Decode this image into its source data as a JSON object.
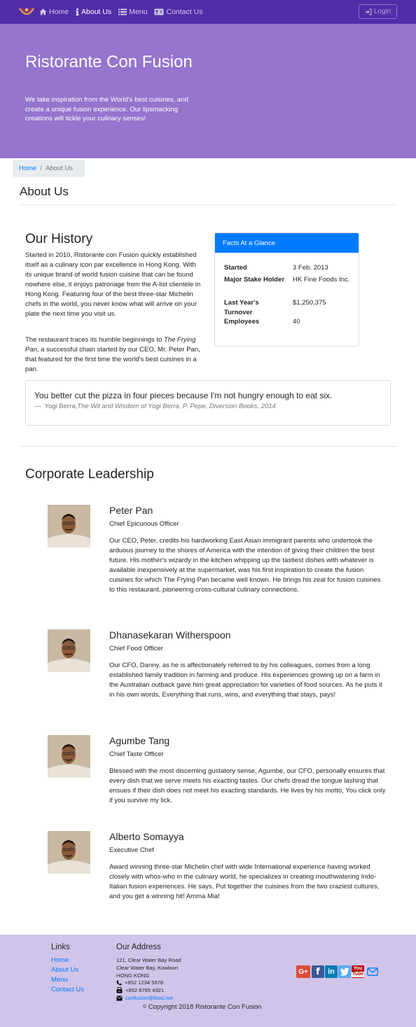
{
  "nav": {
    "items": [
      {
        "label": "Home",
        "icon": "home-icon"
      },
      {
        "label": "About Us",
        "icon": "info-icon",
        "active": true
      },
      {
        "label": "Menu",
        "icon": "list-icon"
      },
      {
        "label": "Contact Us",
        "icon": "address-card-icon"
      }
    ],
    "login_label": "Login",
    "colors": {
      "primary": "#512da8",
      "jumbotron": "#9575cd",
      "footer": "#d1c4e9",
      "accent": "#007bff"
    }
  },
  "jumbotron": {
    "title": "Ristorante Con Fusion",
    "text": "We take inspiration from the World's best cuisines, and create a unique fusion experience. Our lipsmacking creations will tickle your culinary senses!"
  },
  "breadcrumb": {
    "home": "Home",
    "current": "About Us"
  },
  "page_title": "About Us",
  "history": {
    "title": "Our History",
    "p1": "Started in 2010, Ristorante con Fusion quickly established itself as a culinary icon par excellence in Hong Kong. With its unique brand of world fusion cuisine that can be found nowhere else, it enjoys patronage from the A-list clientele in Hong Kong. Featuring four of the best three-star Michelin chefs in the world, you never know what will arrive on your plate the next time you visit us.",
    "p2_before": "The restaurant traces its humble beginnings to ",
    "p2_italic": "The Frying Pan",
    "p2_after": ", a successful chain started by our CEO, Mr. Peter Pan, that featured for the first time the world's best cuisines in a pan."
  },
  "facts": {
    "header": "Facts At a Glance",
    "rows": [
      {
        "term": "Started",
        "value": "3 Feb. 2013"
      },
      {
        "term": "Major Stake Holder",
        "value": "HK Fine Foods Inc."
      },
      {
        "term": "Last Year's Turnover",
        "value": "$1,250,375"
      },
      {
        "term": "Employees",
        "value": "40"
      }
    ]
  },
  "quote": {
    "text": "You better cut the pizza in four pieces because I'm not hungry enough to eat six.",
    "dash": "—",
    "author": "Yogi Berra,",
    "source": "The Wit and Wisdom of Yogi Berra, P. Pepe, Diversion Books, 2014"
  },
  "leadership": {
    "title": "Corporate Leadership",
    "leaders": [
      {
        "name": "Peter Pan",
        "role": "Chief Epicurious Officer",
        "bio": "Our CEO, Peter, credits his hardworking East Asian immigrant parents who undertook the arduous journey to the shores of America with the intention of giving their children the best future. His mother's wizardy in the kitchen whipping up the tastiest dishes with whatever is available inexpensively at the supermarket, was his first inspiration to create the fusion cuisines for which The Frying Pan became well known. He brings his zeal for fusion cuisines to this restaurant, pioneering cross-cultural culinary connections."
      },
      {
        "name": "Dhanasekaran Witherspoon",
        "role": "Chief Food Officer",
        "bio": "Our CFO, Danny, as he is affectionately referred to by his colleagues, comes from a long established family tradition in farming and produce. His experiences growing up on a farm in the Australian outback gave him great appreciation for varieties of food sources. As he puts it in his own words, Everything that runs, wins, and everything that stays, pays!"
      },
      {
        "name": "Agumbe Tang",
        "role": "Chief Taste Officer",
        "bio": "Blessed with the most discerning gustatory sense, Agumbe, our CFO, personally ensures that every dish that we serve meets his exacting tastes. Our chefs dread the tongue lashing that ensues if their dish does not meet his exacting standards. He lives by his motto, You click only if you survive my lick."
      },
      {
        "name": "Alberto Somayya",
        "role": "Executive Chef",
        "bio": "Award winning three-star Michelin chef with wide International experience having worked closely with whos-who in the culinary world, he specializes in creating mouthwatering Indo-Italian fusion experiences. He says, Put together the cuisines from the two craziest cultures, and you get a winning hit! Amma Mia!"
      }
    ]
  },
  "footer": {
    "links_title": "Links",
    "links": [
      "Home",
      "About Us",
      "Menu",
      "Contact Us"
    ],
    "address_title": "Our Address",
    "address": [
      "121, Clear Water Bay Road",
      "Clear Water Bay, Kowloon",
      "HONG KONG"
    ],
    "phone": "+852 1234 5678",
    "fax": "+852 8765 4321",
    "email": "confusion@food.net",
    "social": [
      {
        "icon": "google-plus-icon",
        "color": "#dd4b39"
      },
      {
        "icon": "facebook-icon",
        "color": "#3b5998"
      },
      {
        "icon": "linkedin-icon",
        "color": "#007bb6"
      },
      {
        "icon": "twitter-icon",
        "color": "#55acee"
      },
      {
        "icon": "youtube-icon",
        "color": "#bb0000"
      },
      {
        "icon": "mail-icon",
        "color": "#007bff"
      }
    ],
    "copyright_symbol": "©",
    "copyright": "Copyright 2018 Ristorante Con Fusion"
  }
}
